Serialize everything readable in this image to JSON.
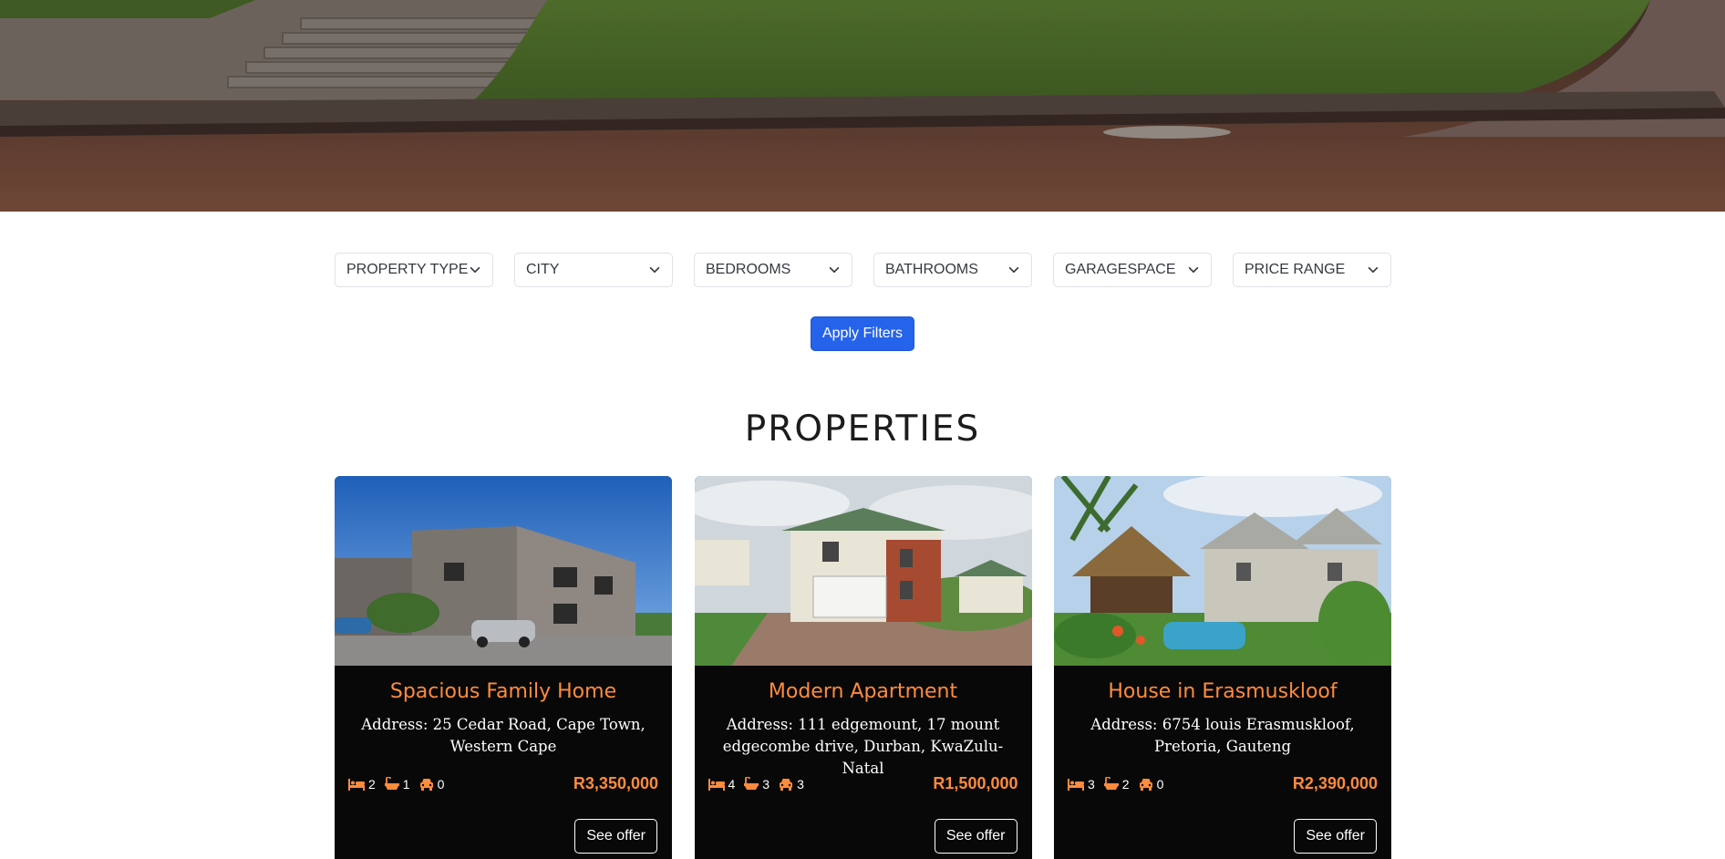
{
  "filters": [
    {
      "label": "PROPERTY TYPE"
    },
    {
      "label": "CITY"
    },
    {
      "label": "BEDROOMS"
    },
    {
      "label": "BATHROOMS"
    },
    {
      "label": "GARAGESPACE"
    },
    {
      "label": "PRICE RANGE"
    }
  ],
  "apply_label": "Apply Filters",
  "section_title": "PROPERTIES",
  "colors": {
    "accent": "#ff8b3d",
    "primary": "#2563eb",
    "card_bg": "#080808"
  },
  "properties": [
    {
      "title": "Spacious Family Home",
      "address": "Address: 25 Cedar Road, Cape Town, Western Cape",
      "bedrooms": "2",
      "bathrooms": "1",
      "garages": "0",
      "price": "R3,350,000",
      "cta": "See offer"
    },
    {
      "title": "Modern Apartment",
      "address": "Address: 111 edgemount, 17 mount edgecombe drive, Durban, KwaZulu-Natal",
      "bedrooms": "4",
      "bathrooms": "3",
      "garages": "3",
      "price": "R1,500,000",
      "cta": "See offer"
    },
    {
      "title": "House in Erasmuskloof",
      "address": "Address: 6754 louis Erasmuskloof, Pretoria, Gauteng",
      "bedrooms": "3",
      "bathrooms": "2",
      "garages": "0",
      "price": "R2,390,000",
      "cta": "See offer"
    }
  ],
  "icons": {
    "bed": "bed-icon",
    "bath": "bath-icon",
    "car": "car-icon",
    "chevron": "chevron-down-icon"
  }
}
